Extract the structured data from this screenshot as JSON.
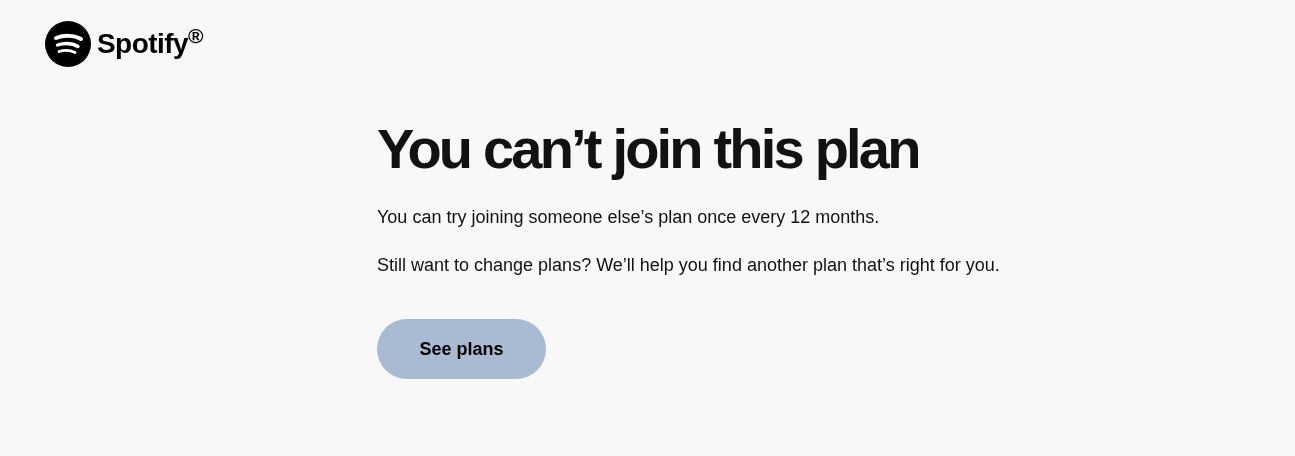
{
  "header": {
    "logo_text": "Spotify$^{®}$"
  },
  "heading": "You can’t join this plan",
  "paragraphs": [
    "You can try joining someone else’s plan once every 12 months.",
    "Still want to change plans? We’ll help you find another plan that’s right for you."
  ],
  "button": {
    "label": "See plans"
  }
}
